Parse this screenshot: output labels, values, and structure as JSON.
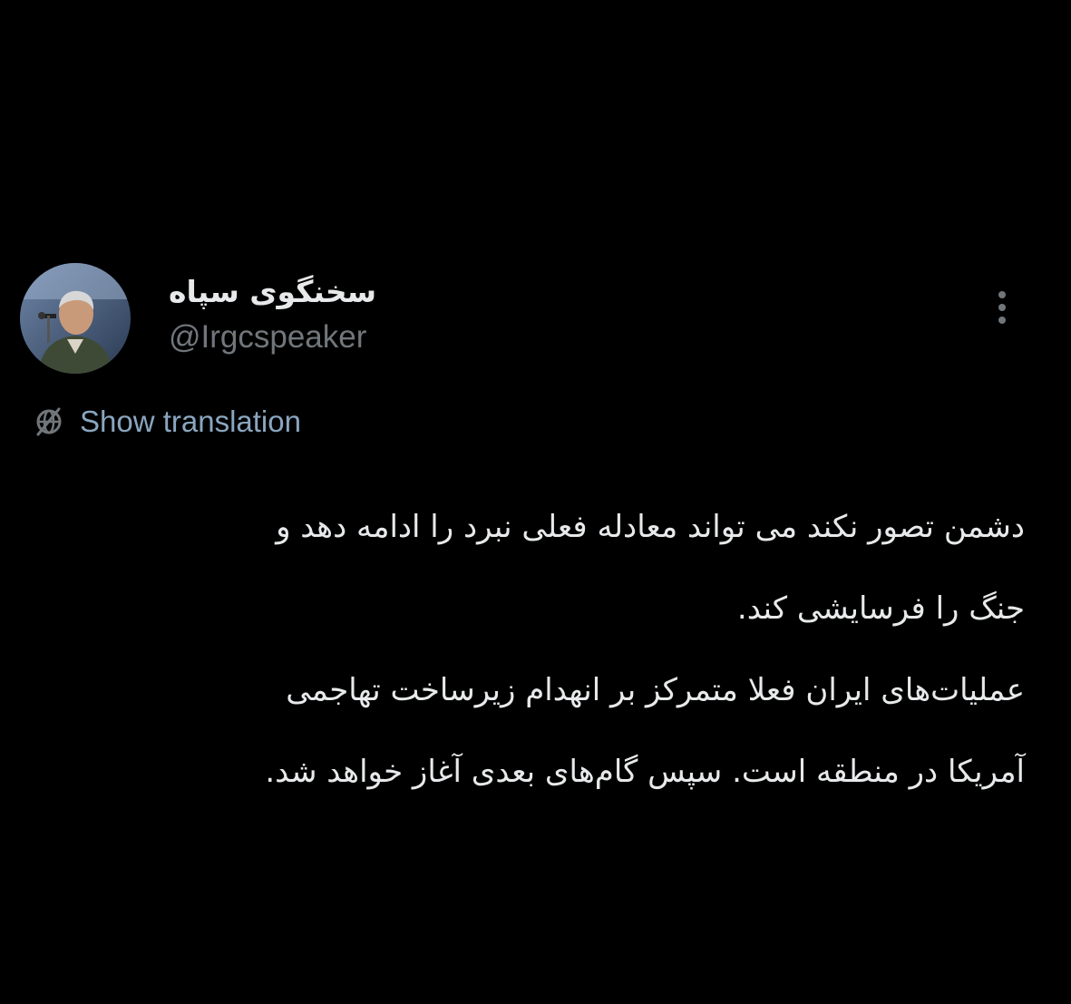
{
  "author": {
    "display_name": "سخنگوی سپاه",
    "handle": "@Irgcspeaker"
  },
  "actions": {
    "more_icon": "more-vertical-icon",
    "translate_icon": "globe-icon",
    "show_translation": "Show translation"
  },
  "tweet": {
    "lines": [
      "دشمن تصور نکند می تواند معادله فعلی نبرد را ادامه دهد و",
      "جنگ را فرسایشی کند.",
      "عملیات‌های ایران فعلا متمرکز بر انهدام زیرساخت تهاجمی",
      "آمریکا در منطقه است. سپس گام‌های بعدی آغاز خواهد شد."
    ]
  },
  "colors": {
    "background": "#000000",
    "primary_text": "#e7e9ea",
    "secondary_text": "#71767b",
    "link": "#8aa6bf"
  }
}
